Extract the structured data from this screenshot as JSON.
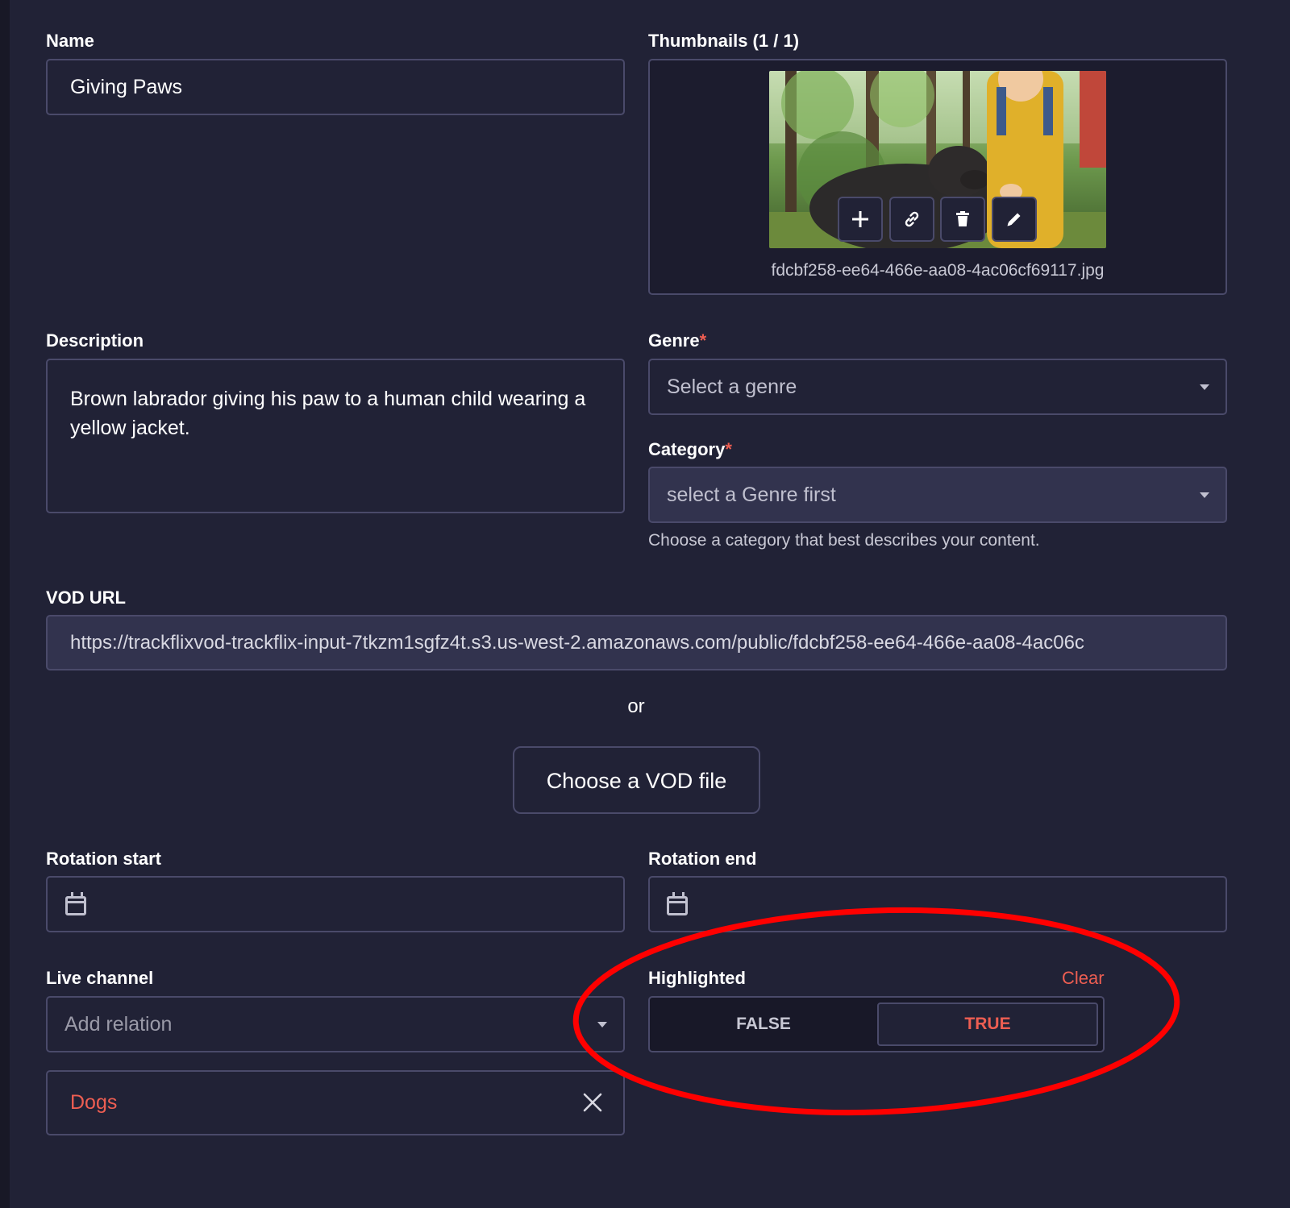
{
  "form": {
    "name": {
      "label": "Name",
      "value": "Giving Paws"
    },
    "thumbnails": {
      "label": "Thumbnails (1 / 1)",
      "filename": "fdcbf258-ee64-466e-aa08-4ac06cf69117.jpg",
      "actions": [
        "add-icon",
        "link-icon",
        "trash-icon",
        "pencil-icon"
      ]
    },
    "description": {
      "label": "Description",
      "value": "Brown labrador giving his paw to a human child wearing a yellow jacket."
    },
    "genre": {
      "label": "Genre",
      "required_mark": "*",
      "placeholder": "Select a genre"
    },
    "category": {
      "label": "Category",
      "required_mark": "*",
      "placeholder": "select a Genre first",
      "hint": "Choose a category that best describes your content."
    },
    "vod_url": {
      "label": "VOD URL",
      "value": "https://trackflixvod-trackflix-input-7tkzm1sgfz4t.s3.us-west-2.amazonaws.com/public/fdcbf258-ee64-466e-aa08-4ac06c"
    },
    "or_text": "or",
    "choose_file_label": "Choose a VOD file",
    "rotation_start": {
      "label": "Rotation start"
    },
    "rotation_end": {
      "label": "Rotation end"
    },
    "live_channel": {
      "label": "Live channel",
      "placeholder": "Add relation",
      "relation": "Dogs"
    },
    "highlighted": {
      "label": "Highlighted",
      "clear_label": "Clear",
      "false_label": "FALSE",
      "true_label": "TRUE",
      "selected": "TRUE"
    }
  },
  "colors": {
    "background": "#212236",
    "accent_red": "#ee5e52",
    "border": "#4a4a6a",
    "annotation_red": "#ff0000"
  }
}
